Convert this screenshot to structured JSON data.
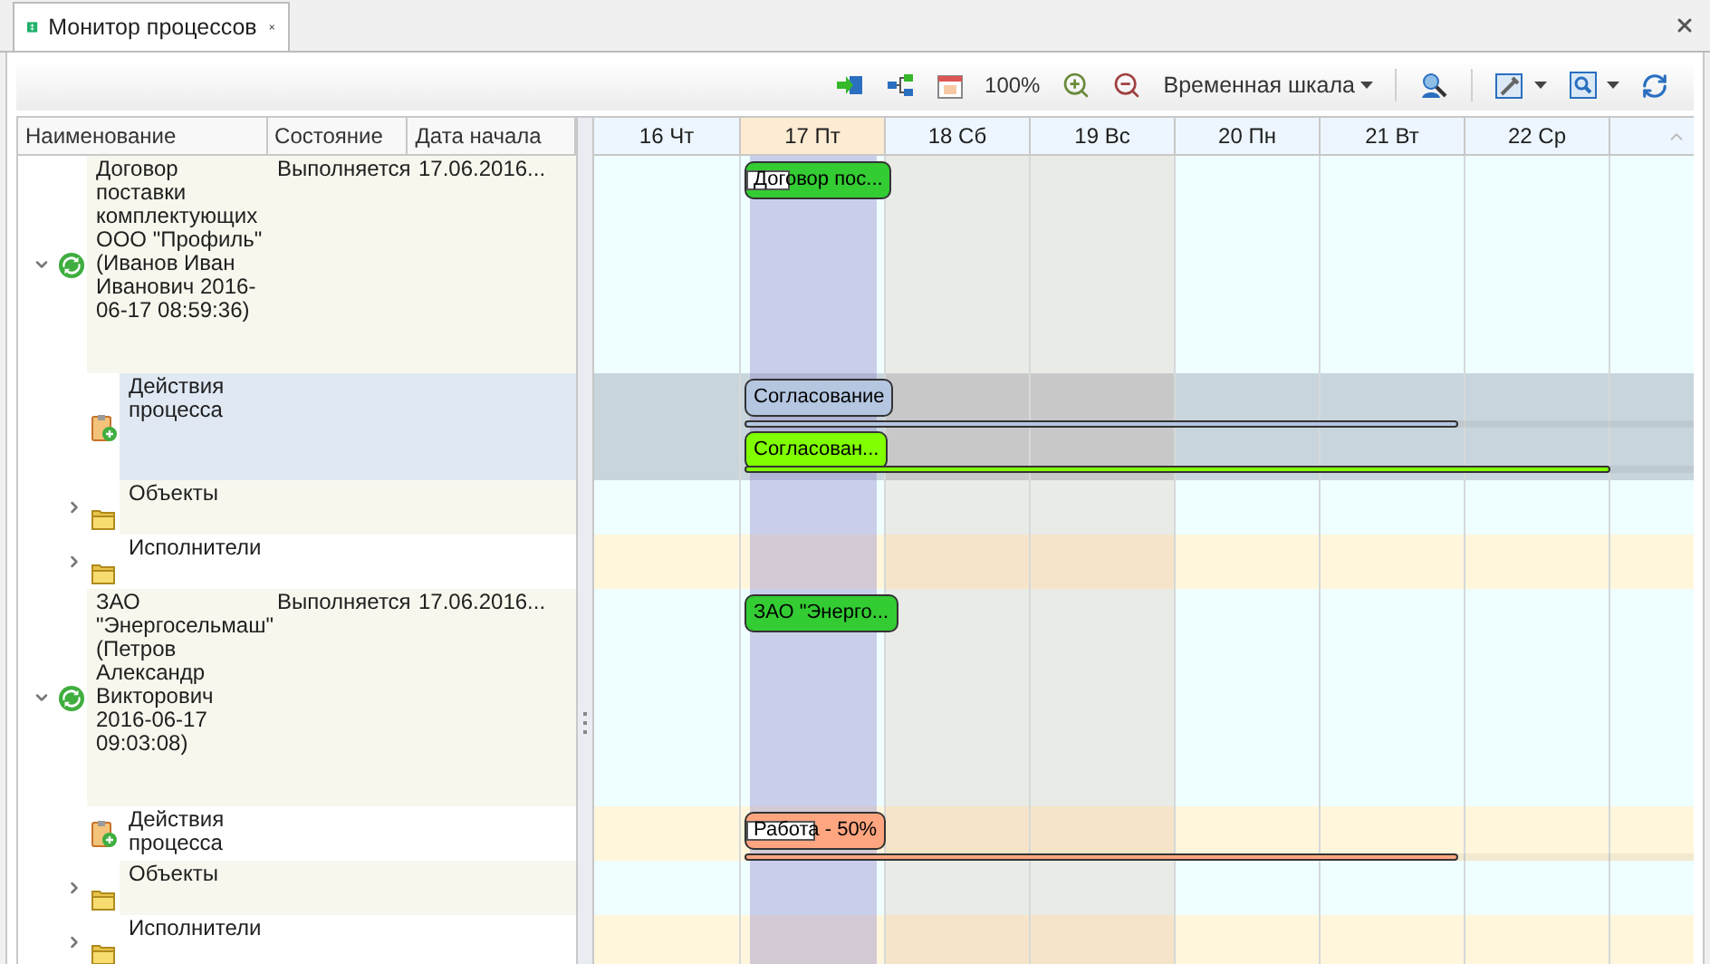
{
  "tab": {
    "title": "Монитор процессов",
    "selected": true
  },
  "toolbar": {
    "zoom": "100%",
    "timescale": "Временная шкала"
  },
  "columns": [
    "Наименование",
    "Состояние",
    "Дата начала"
  ],
  "days": [
    {
      "label": "16 Чт",
      "kind": "workday",
      "selected": false
    },
    {
      "label": "17 Пт",
      "kind": "today",
      "selected": true
    },
    {
      "label": "18 Сб",
      "kind": "weekend",
      "selected": false
    },
    {
      "label": "19 Вс",
      "kind": "weekend",
      "selected": false
    },
    {
      "label": "20 Пн",
      "kind": "workday",
      "selected": false
    },
    {
      "label": "21 Вт",
      "kind": "workday",
      "selected": false
    },
    {
      "label": "22 Ср",
      "kind": "workday",
      "selected": false
    }
  ],
  "tree": [
    {
      "kind": "process",
      "name": "Договор поставки комплектующих ООО \"Профиль\" (Иванов Иван Иванович 2016-06-17 08:59:36)",
      "status": "Выполняется",
      "start": "17.06.2016...",
      "expanded": true,
      "selected": false,
      "bars": [
        {
          "label": "Договор пос...",
          "color": "#33cc33",
          "level": 0.3
        }
      ],
      "children": [
        {
          "kind": "actions",
          "name": "Действия процесса",
          "selected": true,
          "bars": [
            {
              "label": "Согласование",
              "color": "#b4c6e0",
              "line": {
                "level": 0.75
              }
            },
            {
              "label": "Согласован...",
              "color": "#80ff00",
              "line": {
                "level": 0.91
              }
            }
          ]
        },
        {
          "kind": "folder",
          "name": "Объекты",
          "expanded": false,
          "selected": false
        },
        {
          "kind": "folder",
          "name": "Исполнители",
          "expanded": false,
          "selected": false
        }
      ]
    },
    {
      "kind": "process",
      "name": "ЗАО \"Энергосельмаш\" (Петров Александр Викторович 2016-06-17 09:03:08)",
      "status": "Выполняется",
      "start": "17.06.2016...",
      "expanded": true,
      "selected": false,
      "bars": [
        {
          "label": "ЗАО \"Энерго...",
          "color": "#33cc33"
        }
      ],
      "children": [
        {
          "kind": "actions",
          "name": "Действия процесса",
          "selected": false,
          "bars": [
            {
              "label": "Работа - 50%",
              "color": "#ffa680",
              "level": 0.5,
              "line": {
                "level": 0.75
              }
            }
          ]
        },
        {
          "kind": "folder",
          "name": "Объекты",
          "expanded": false,
          "selected": false
        },
        {
          "kind": "folder",
          "name": "Исполнители",
          "expanded": false,
          "selected": false
        }
      ]
    }
  ]
}
